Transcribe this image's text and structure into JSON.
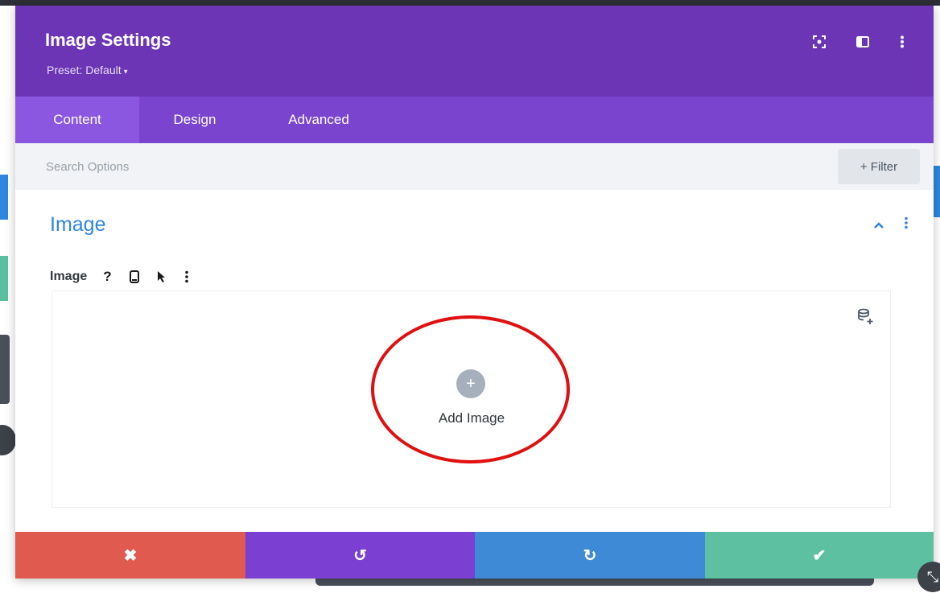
{
  "modal": {
    "title": "Image Settings",
    "preset_label": "Preset: Default",
    "header_icons": [
      "focus-icon",
      "sidebar-layout-icon",
      "more-vertical-icon"
    ]
  },
  "tabs": [
    {
      "label": "Content",
      "active": true
    },
    {
      "label": "Design",
      "active": false
    },
    {
      "label": "Advanced",
      "active": false
    }
  ],
  "search": {
    "placeholder": "Search Options",
    "filter_label": "+ Filter"
  },
  "section": {
    "title": "Image",
    "expanded": true
  },
  "field": {
    "label": "Image",
    "help_glyph": "?"
  },
  "upload": {
    "button_glyph": "+",
    "label": "Add Image"
  },
  "footer": {
    "buttons": [
      {
        "name": "discard",
        "glyph": "✖",
        "color": "#e05a4f"
      },
      {
        "name": "undo",
        "glyph": "↺",
        "color": "#7b3fd1"
      },
      {
        "name": "redo",
        "glyph": "↻",
        "color": "#3e8ad6"
      },
      {
        "name": "save",
        "glyph": "✔",
        "color": "#5cc0a1"
      }
    ]
  },
  "colors": {
    "header": "#6c35b5",
    "tabs": "#7a44cf",
    "accent_blue": "#2e86de",
    "highlight": "#e01010"
  }
}
